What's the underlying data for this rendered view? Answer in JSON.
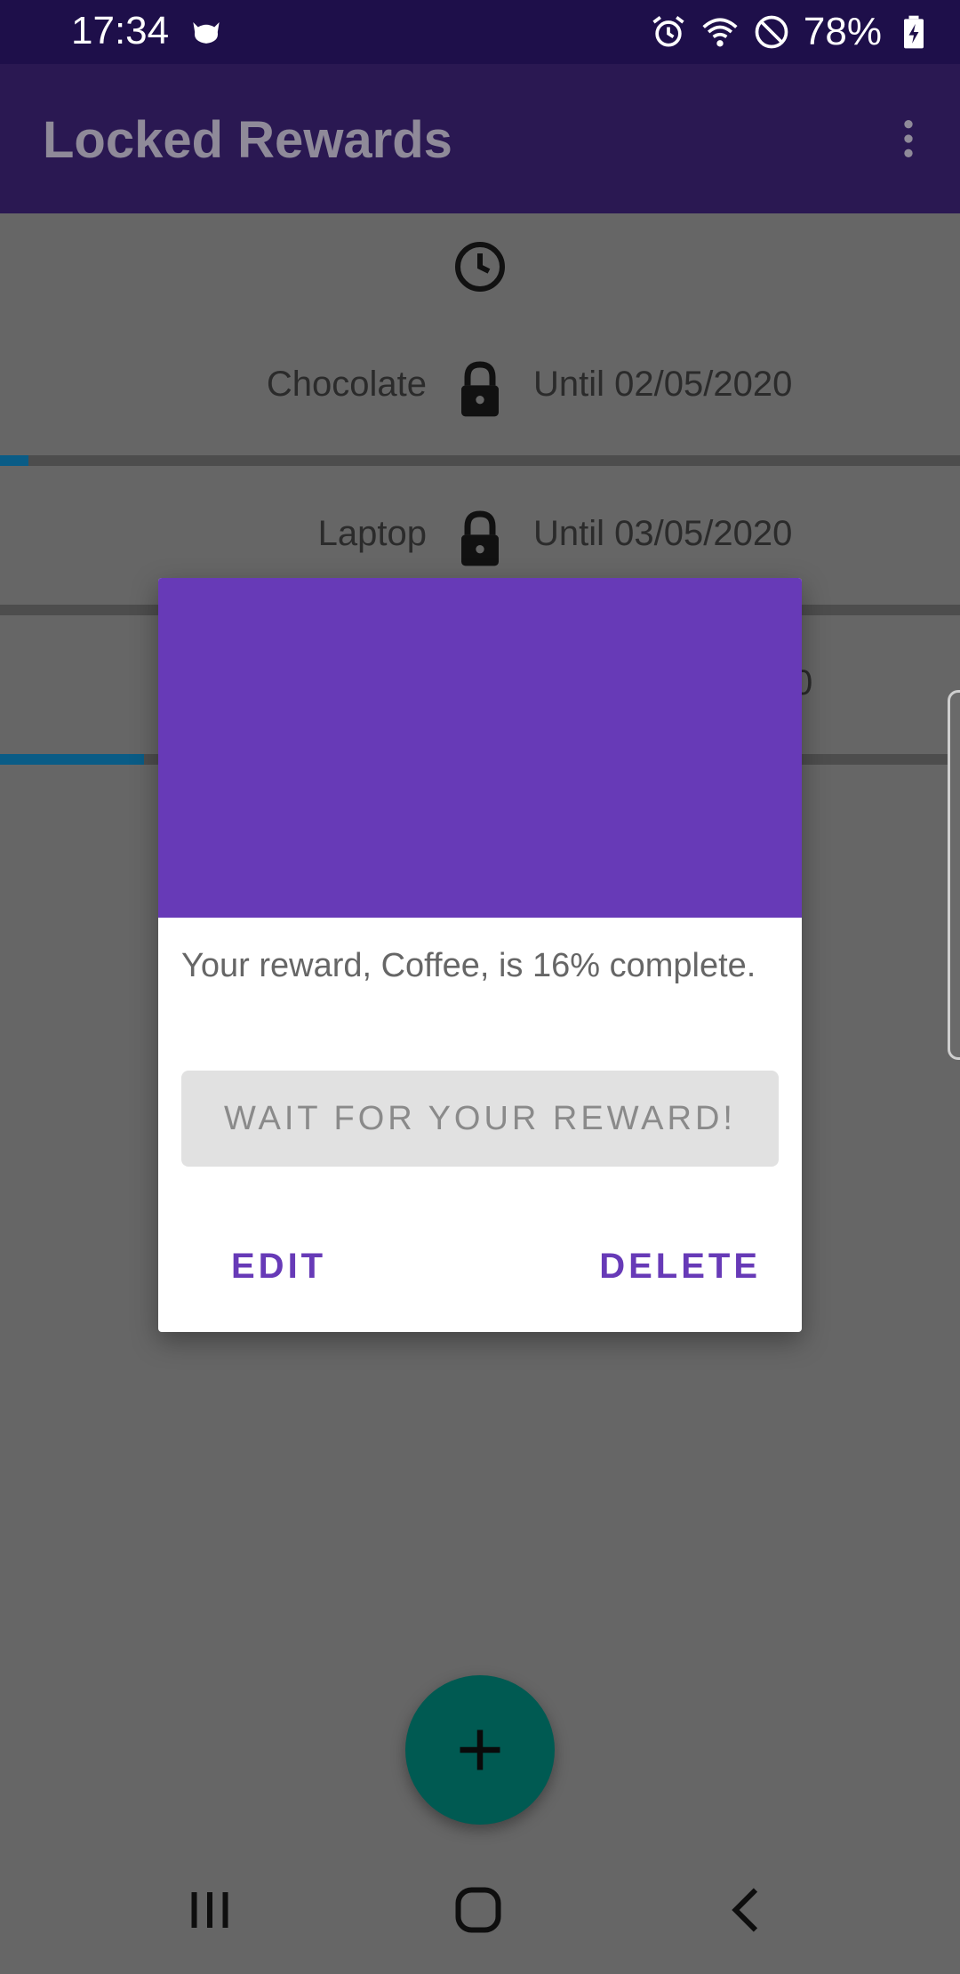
{
  "status_bar": {
    "time": "17:34",
    "battery": "78%",
    "icons": [
      "cat-notification-icon",
      "alarm-icon",
      "wifi-icon",
      "do-not-disturb-icon",
      "battery-charging-icon"
    ]
  },
  "app_bar": {
    "title": "Locked Rewards",
    "menu_icon": "more-vert-icon"
  },
  "list": {
    "header_icon": "clock-icon",
    "items": [
      {
        "name": "Chocolate",
        "until": "Until 02/05/2020",
        "progress": 0.03,
        "icon": "lock-icon"
      },
      {
        "name": "Laptop",
        "until": "Until 03/05/2020",
        "progress": 0.0,
        "icon": "lock-icon"
      },
      {
        "name": "",
        "until": "0",
        "progress": 0.16,
        "icon": "lock-icon"
      }
    ]
  },
  "dialog": {
    "message": "Your reward, Coffee, is 16% complete.",
    "wait_label": "WAIT FOR YOUR REWARD!",
    "edit_label": "EDIT",
    "delete_label": "DELETE",
    "banner_color": "#673ab7"
  },
  "fab": {
    "icon": "plus-icon"
  },
  "nav_bar": {
    "buttons": [
      "recent-apps-icon",
      "home-icon",
      "back-icon"
    ]
  },
  "colors": {
    "accent": "#673ab7",
    "progress": "#0288d1",
    "fab": "#009688"
  }
}
